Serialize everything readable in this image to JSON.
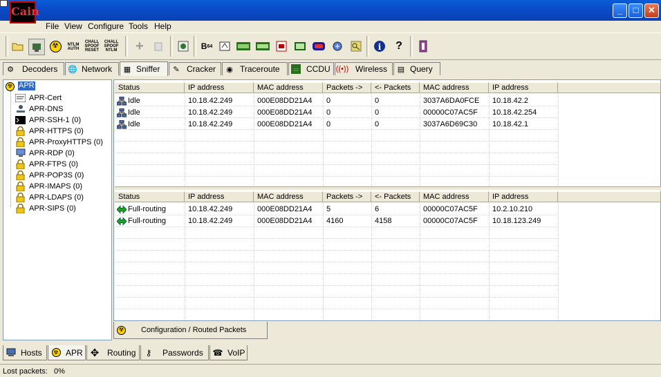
{
  "window": {
    "logo_text": "Cain",
    "minimize": "_",
    "maximize": "□",
    "close": "✕"
  },
  "menu": [
    "File",
    "View",
    "Configure",
    "Tools",
    "Help"
  ],
  "toolbar": {
    "ntlm_auth": "NTLM AUTH",
    "chall_spoof_reset": "CHALL SPOOF RESET",
    "chall_spoof_ntlm": "CHALL SPOOF NTLM",
    "b64": "B",
    "b64_sub": "64"
  },
  "tabs": [
    "Decoders",
    "Network",
    "Sniffer",
    "Cracker",
    "Traceroute",
    "CCDU",
    "Wireless",
    "Query"
  ],
  "active_tab": "Sniffer",
  "tree": {
    "root": "APR",
    "items": [
      "APR-Cert",
      "APR-DNS",
      "APR-SSH-1 (0)",
      "APR-HTTPS (0)",
      "APR-ProxyHTTPS (0)",
      "APR-RDP (0)",
      "APR-FTPS (0)",
      "APR-POP3S (0)",
      "APR-IMAPS (0)",
      "APR-LDAPS (0)",
      "APR-SIPS (0)"
    ]
  },
  "top_table": {
    "columns": [
      "Status",
      "IP address",
      "MAC address",
      "Packets ->",
      "<- Packets",
      "MAC address",
      "IP address"
    ],
    "rows": [
      [
        "Idle",
        "10.18.42.249",
        "000E08DD21A4",
        "0",
        "0",
        "3037A6DA0FCE",
        "10.18.42.2"
      ],
      [
        "Idle",
        "10.18.42.249",
        "000E08DD21A4",
        "0",
        "0",
        "00000C07AC5F",
        "10.18.42.254"
      ],
      [
        "Idle",
        "10.18.42.249",
        "000E08DD21A4",
        "0",
        "0",
        "3037A6D69C30",
        "10.18.42.1"
      ]
    ]
  },
  "bottom_table": {
    "columns": [
      "Status",
      "IP address",
      "MAC address",
      "Packets ->",
      "<- Packets",
      "MAC address",
      "IP address"
    ],
    "rows": [
      [
        "Full-routing",
        "10.18.42.249",
        "000E08DD21A4",
        "5",
        "6",
        "00000C07AC5F",
        "10.2.10.210"
      ],
      [
        "Full-routing",
        "10.18.42.249",
        "000E08DD21A4",
        "4160",
        "4158",
        "00000C07AC5F",
        "10.18.123.249"
      ]
    ]
  },
  "subtab": "Configuration / Routed Packets",
  "bottom_tabs": [
    "Hosts",
    "APR",
    "Routing",
    "Passwords",
    "VoIP"
  ],
  "active_bottom_tab": "APR",
  "status": {
    "label": "Lost packets:",
    "value": "0%"
  }
}
